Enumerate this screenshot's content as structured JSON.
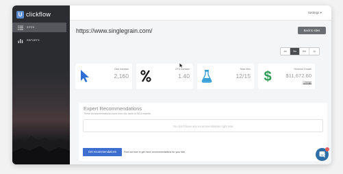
{
  "app": {
    "logo_mark": "U",
    "name": "clickflow"
  },
  "sidebar": {
    "items": [
      {
        "label": "SITES",
        "icon": "list-icon",
        "active": true
      },
      {
        "label": "REPORTS",
        "icon": "bar-chart-icon",
        "active": false
      }
    ]
  },
  "header": {
    "settings_label": "Settings ▾"
  },
  "site": {
    "url": "https://www.singlegrain.com/",
    "back_label": "Back to sites"
  },
  "range": {
    "options": [
      "1w",
      "3m",
      "6m",
      "1y"
    ],
    "selected": "3m"
  },
  "stats": [
    {
      "icon": "cursor-icon",
      "label": "Click Increase",
      "value": "2,160",
      "extra": ""
    },
    {
      "icon": "percent-icon",
      "label": "CTR Increase",
      "value": "1.40",
      "extra": ""
    },
    {
      "icon": "flask-icon",
      "label": "Tests Won",
      "value": "12/15",
      "extra": ""
    },
    {
      "icon": "dollar-icon",
      "label": "Revenue Growth",
      "value": "$11,672.60",
      "extra": "Change"
    }
  ],
  "recommendations": {
    "title": "Expert Recommendations",
    "subtitle": "These recommendations come from our team of SEO experts",
    "empty_text": "You don't have any recommendations right now",
    "button_label": "Get recommendations",
    "link_text": "Find out how to get more recommendations for your site"
  },
  "colors": {
    "accent": "#3e6fd0",
    "cursor_icon": "#2f6ed4",
    "flask_icon": "#3aa0d8",
    "dollar_icon": "#2d9b55",
    "chat": "#2f6fa8",
    "badge": "#e35d5b"
  }
}
